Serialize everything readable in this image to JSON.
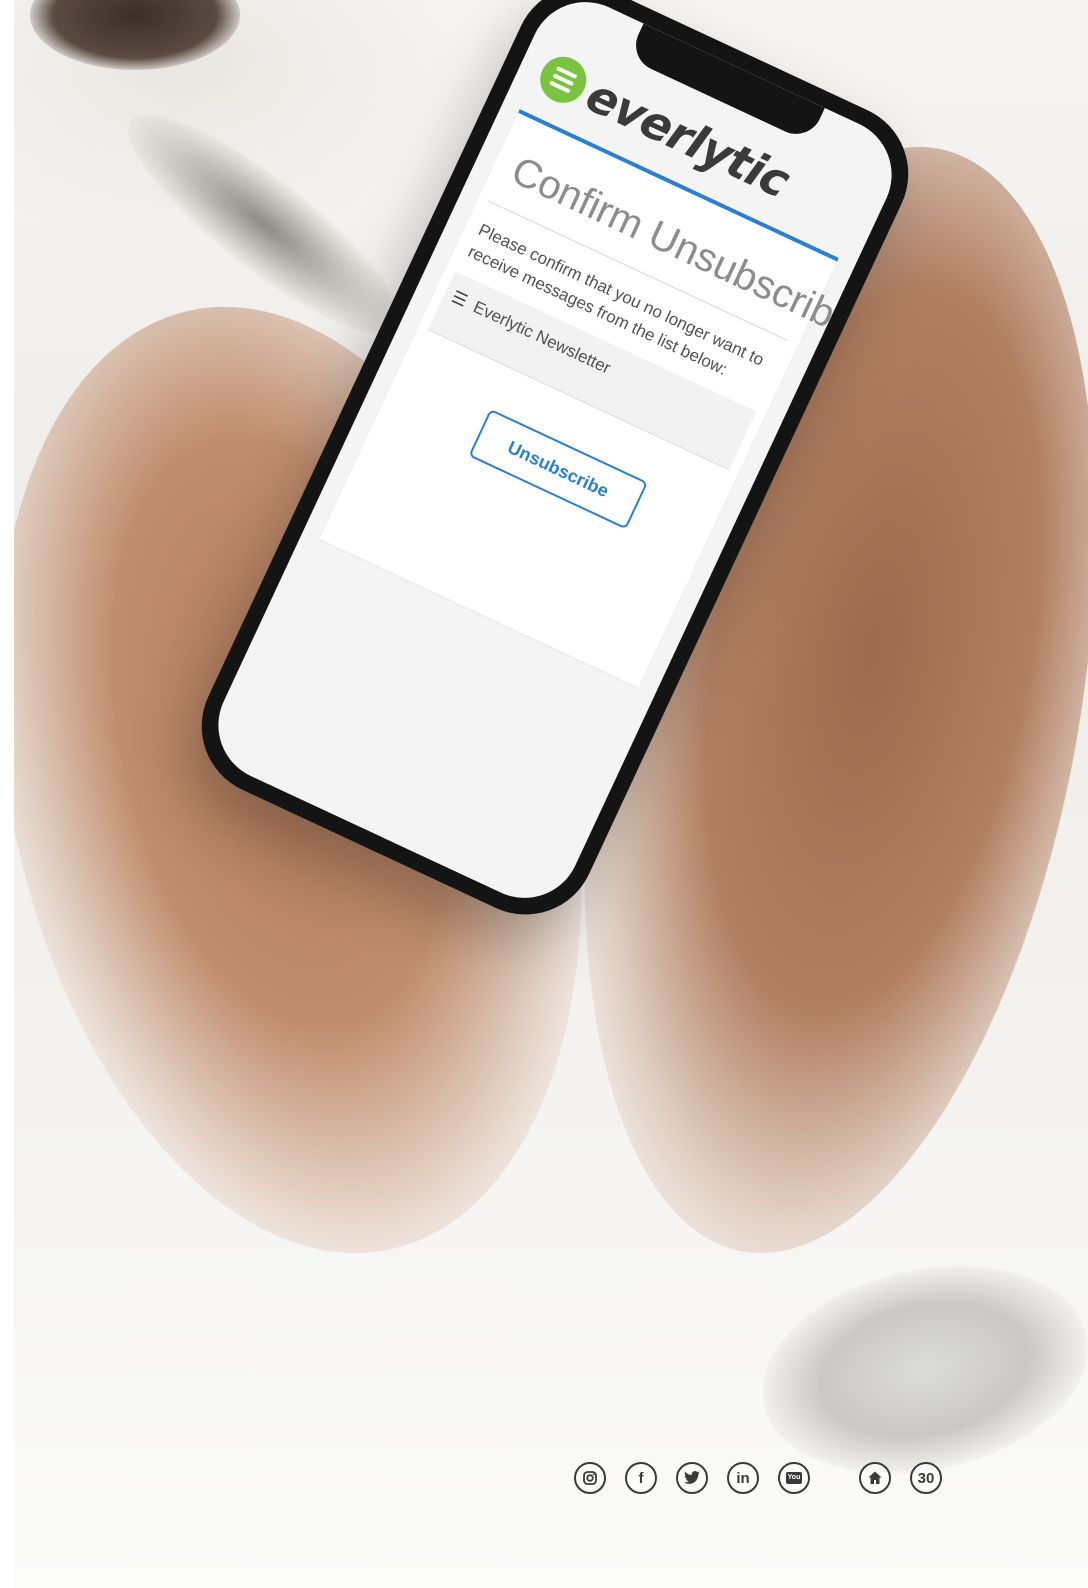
{
  "brand": {
    "name": "everlytic",
    "logo_color": "#7cc242"
  },
  "accent_color": "#2b7fd0",
  "page": {
    "title": "Confirm Unsubscribe",
    "message": "Please confirm that you no longer want to receive messages from the list below:",
    "list_icon": "list-icon",
    "list_item": "Everlytic Newsletter",
    "button_label": "Unsubscribe"
  },
  "footer": {
    "social_icons": [
      "instagram-icon",
      "facebook-icon",
      "twitter-icon",
      "linkedin-icon",
      "youtube-icon"
    ],
    "facebook_glyph": "f",
    "linkedin_glyph": "in",
    "youtube_glyph": "You",
    "home_icon": "home-icon",
    "page_number": "30"
  }
}
